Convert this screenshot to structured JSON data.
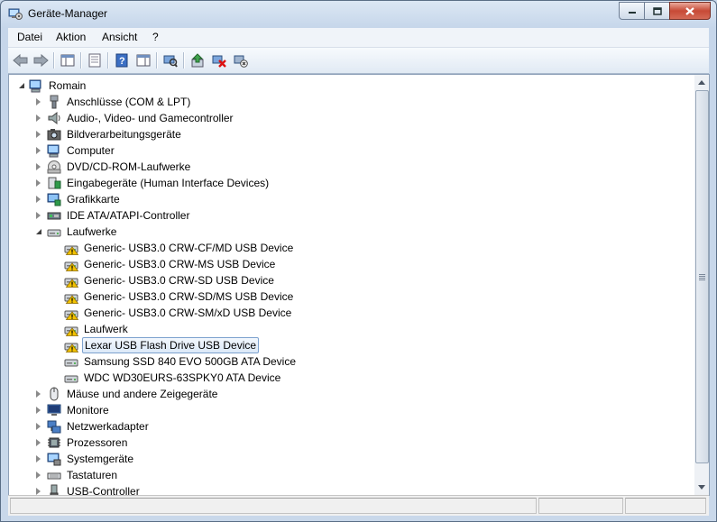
{
  "window": {
    "title": "Geräte-Manager",
    "icon": "device-manager-icon"
  },
  "menu": {
    "items": [
      {
        "label": "Datei"
      },
      {
        "label": "Aktion"
      },
      {
        "label": "Ansicht"
      },
      {
        "label": "?"
      }
    ]
  },
  "toolbar": {
    "buttons": [
      {
        "icon": "back-arrow-icon"
      },
      {
        "icon": "forward-arrow-icon"
      },
      {
        "icon": "show-hide-console-tree-icon"
      },
      {
        "icon": "properties-icon"
      },
      {
        "icon": "help-icon"
      },
      {
        "icon": "action-pane-icon"
      },
      {
        "icon": "scan-hardware-icon"
      },
      {
        "icon": "update-driver-icon"
      },
      {
        "icon": "uninstall-icon"
      },
      {
        "icon": "disable-device-icon"
      }
    ]
  },
  "tree": {
    "root": {
      "label": "Romain",
      "icon": "computer-icon"
    },
    "categories": [
      {
        "label": "Anschlüsse (COM & LPT)",
        "icon": "port-icon"
      },
      {
        "label": "Audio-, Video- und Gamecontroller",
        "icon": "speaker-icon"
      },
      {
        "label": "Bildverarbeitungsgeräte",
        "icon": "camera-icon"
      },
      {
        "label": "Computer",
        "icon": "computer-icon"
      },
      {
        "label": "DVD/CD-ROM-Laufwerke",
        "icon": "cd-drive-icon"
      },
      {
        "label": "Eingabegeräte (Human Interface Devices)",
        "icon": "hid-icon"
      },
      {
        "label": "Grafikkarte",
        "icon": "display-adapter-icon"
      },
      {
        "label": "IDE ATA/ATAPI-Controller",
        "icon": "ide-controller-icon"
      },
      {
        "label": "Laufwerke",
        "icon": "disk-drive-icon",
        "expanded": true
      }
    ],
    "drives": [
      {
        "label": "Generic- USB3.0 CRW-CF/MD USB Device",
        "warning": true
      },
      {
        "label": "Generic- USB3.0 CRW-MS USB Device",
        "warning": true
      },
      {
        "label": "Generic- USB3.0 CRW-SD USB Device",
        "warning": true
      },
      {
        "label": "Generic- USB3.0 CRW-SD/MS USB Device",
        "warning": true
      },
      {
        "label": "Generic- USB3.0 CRW-SM/xD USB Device",
        "warning": true
      },
      {
        "label": "Laufwerk",
        "warning": true
      },
      {
        "label": "Lexar USB Flash Drive USB Device",
        "warning": true,
        "selected": true
      },
      {
        "label": "Samsung SSD 840 EVO 500GB ATA Device",
        "warning": false
      },
      {
        "label": "WDC WD30EURS-63SPKY0 ATA Device",
        "warning": false
      }
    ],
    "categories_after": [
      {
        "label": "Mäuse und andere Zeigegeräte",
        "icon": "mouse-icon"
      },
      {
        "label": "Monitore",
        "icon": "monitor-icon"
      },
      {
        "label": "Netzwerkadapter",
        "icon": "network-adapter-icon"
      },
      {
        "label": "Prozessoren",
        "icon": "processor-icon"
      },
      {
        "label": "Systemgeräte",
        "icon": "system-device-icon"
      },
      {
        "label": "Tastaturen",
        "icon": "keyboard-icon"
      },
      {
        "label": "USB-Controller",
        "icon": "usb-controller-icon"
      }
    ]
  },
  "colors": {
    "warning": "#f2c200",
    "selection_border": "#7da2ce"
  }
}
